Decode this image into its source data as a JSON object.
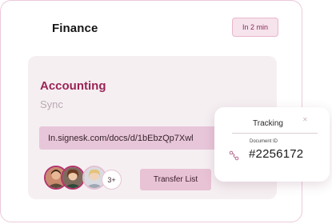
{
  "header": {
    "title": "Finance",
    "time_badge": "In 2 min"
  },
  "card": {
    "title": "Accounting",
    "subtitle": "Sync",
    "url": "In.signesk.com/docs/d/1bEbzQp7Xwl"
  },
  "team": {
    "avatars": [
      "avatar-person-1",
      "avatar-person-2",
      "avatar-person-3"
    ],
    "more_count": "3+"
  },
  "actions": {
    "transfer_label": "Transfer List"
  },
  "tracking": {
    "title": "Tracking",
    "close_icon": "close-icon",
    "document_label": "Document ID",
    "document_id": "#2256172",
    "route_icon": "route-icon"
  },
  "colors": {
    "accent": "#9b2454",
    "card_bg": "#f5eff2",
    "field_bg": "#e8c6d9",
    "badge_bg": "#f6e3ec"
  }
}
